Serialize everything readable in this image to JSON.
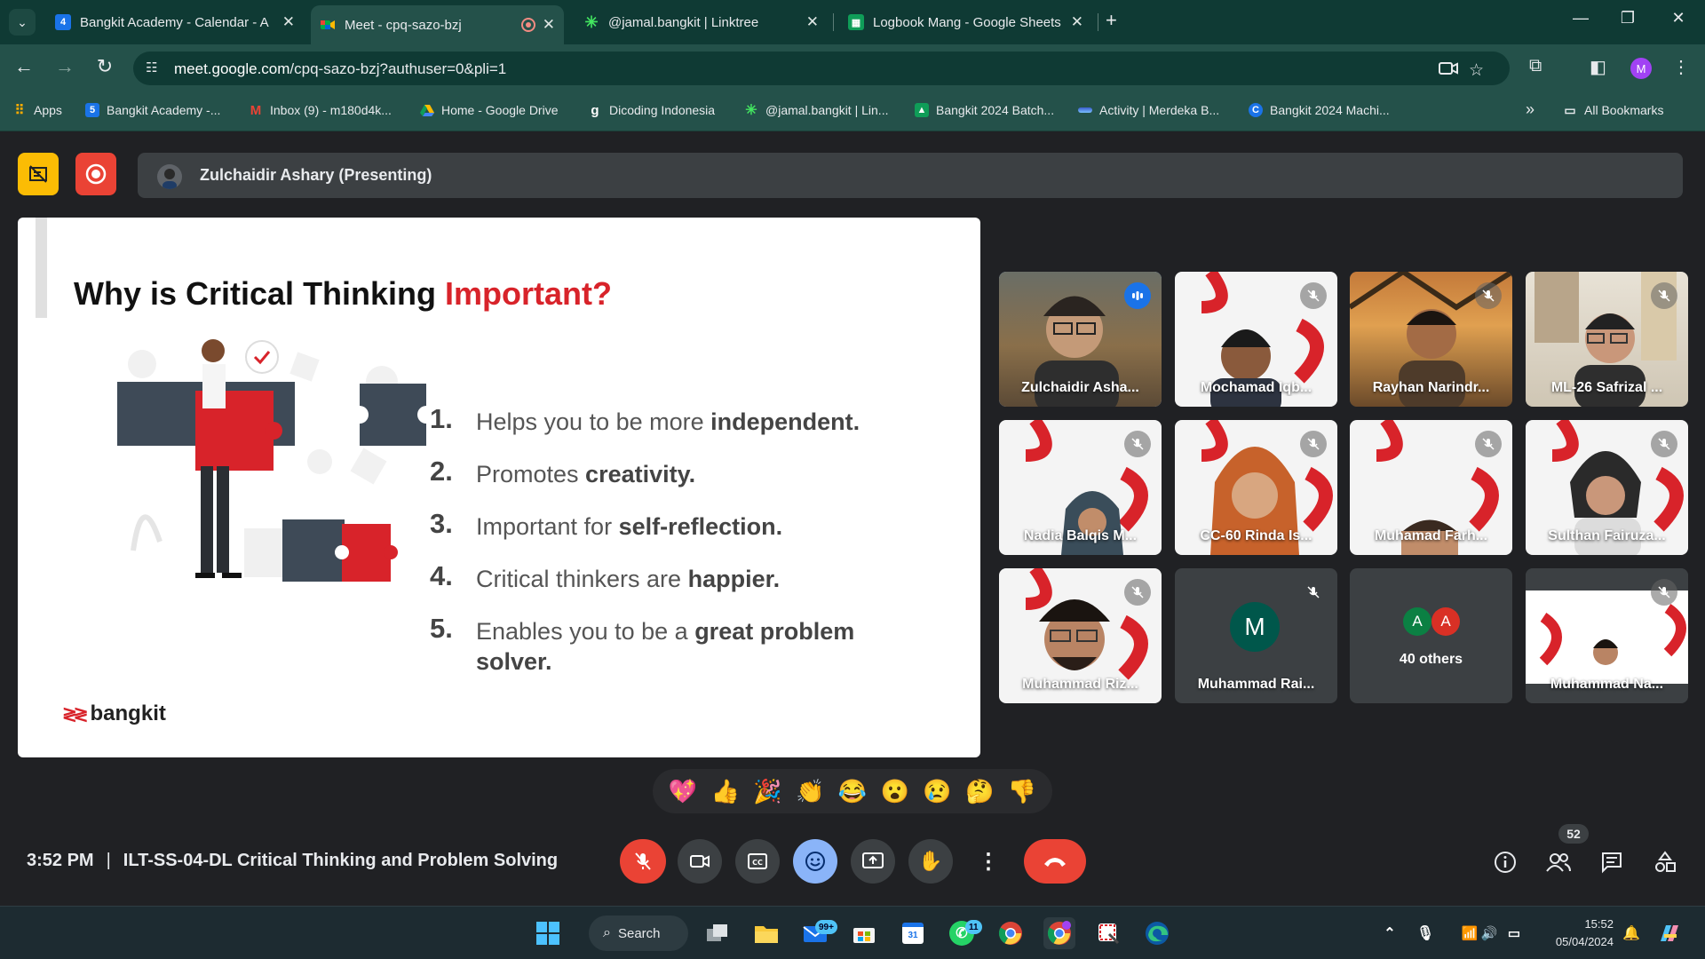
{
  "browser": {
    "tabs": [
      {
        "title": "Bangkit Academy - Calendar - A",
        "favicon": "calendar-favicon",
        "active": false
      },
      {
        "title": "Meet - cpq-sazo-bzj",
        "favicon": "meet-favicon",
        "active": true
      },
      {
        "title": "@jamal.bangkit | Linktree",
        "favicon": "linktree-favicon",
        "active": false
      },
      {
        "title": "Logbook Mang - Google Sheets",
        "favicon": "sheets-favicon",
        "active": false
      }
    ],
    "url_host": "meet.google.com",
    "url_path": "/cpq-sazo-bzj?authuser=0&pli=1",
    "profile_initial": "M",
    "bookmarks": [
      {
        "label": "Apps"
      },
      {
        "label": "Bangkit Academy -..."
      },
      {
        "label": "Inbox (9) - m180d4k..."
      },
      {
        "label": "Home - Google Drive"
      },
      {
        "label": "Dicoding Indonesia"
      },
      {
        "label": "@jamal.bangkit | Lin..."
      },
      {
        "label": "Bangkit 2024 Batch..."
      },
      {
        "label": "Activity | Merdeka B..."
      },
      {
        "label": "Bangkit 2024 Machi..."
      }
    ],
    "all_bookmarks": "All Bookmarks"
  },
  "meet": {
    "presenter": "Zulchaidir Ashary (Presenting)",
    "slide": {
      "title_black": "Why is Critical Thinking ",
      "title_red": "Important?",
      "points": [
        {
          "num": "1.",
          "text": "Helps you to be more ",
          "bold": "independent."
        },
        {
          "num": "2.",
          "text": "Promotes ",
          "bold": "creativity."
        },
        {
          "num": "3.",
          "text": "Important for ",
          "bold": "self-reflection."
        },
        {
          "num": "4.",
          "text": "Critical thinkers are ",
          "bold": "happier."
        },
        {
          "num": "5.",
          "text": "Enables you to be a ",
          "bold": "great problem solver."
        }
      ],
      "logo": "bangkit"
    },
    "participants": [
      {
        "name": "Zulchaidir Asha...",
        "speaking": true
      },
      {
        "name": "Mochamad Iqb...",
        "muted": true
      },
      {
        "name": "Rayhan Narindr...",
        "muted": true
      },
      {
        "name": "ML-26 Safrizal ...",
        "muted": true
      },
      {
        "name": "Nadia Balqis M...",
        "muted": true
      },
      {
        "name": "CC-60 Rinda Is...",
        "muted": true
      },
      {
        "name": "Muhamad Farh...",
        "muted": true
      },
      {
        "name": "Sulthan Fairuza...",
        "muted": true
      },
      {
        "name": "Muhammad Riz...",
        "muted": true
      },
      {
        "name": "Muhammad Rai...",
        "muted": true,
        "initial": "M"
      },
      {
        "name": "40 others",
        "initials": [
          "A",
          "A"
        ]
      },
      {
        "name": "Muhammad Na...",
        "muted": true
      }
    ],
    "reactions": [
      "💖",
      "👍",
      "🎉",
      "👏",
      "😂",
      "😮",
      "😢",
      "🤔",
      "👎"
    ],
    "time": "3:52 PM",
    "meeting_title": "ILT-SS-04-DL Critical Thinking and Problem Solving",
    "people_count": "52"
  },
  "taskbar": {
    "search_label": "Search",
    "mail_badge": "99+",
    "whatsapp_badge": "11",
    "calendar_day": "31",
    "time": "15:52",
    "date": "05/04/2024"
  }
}
